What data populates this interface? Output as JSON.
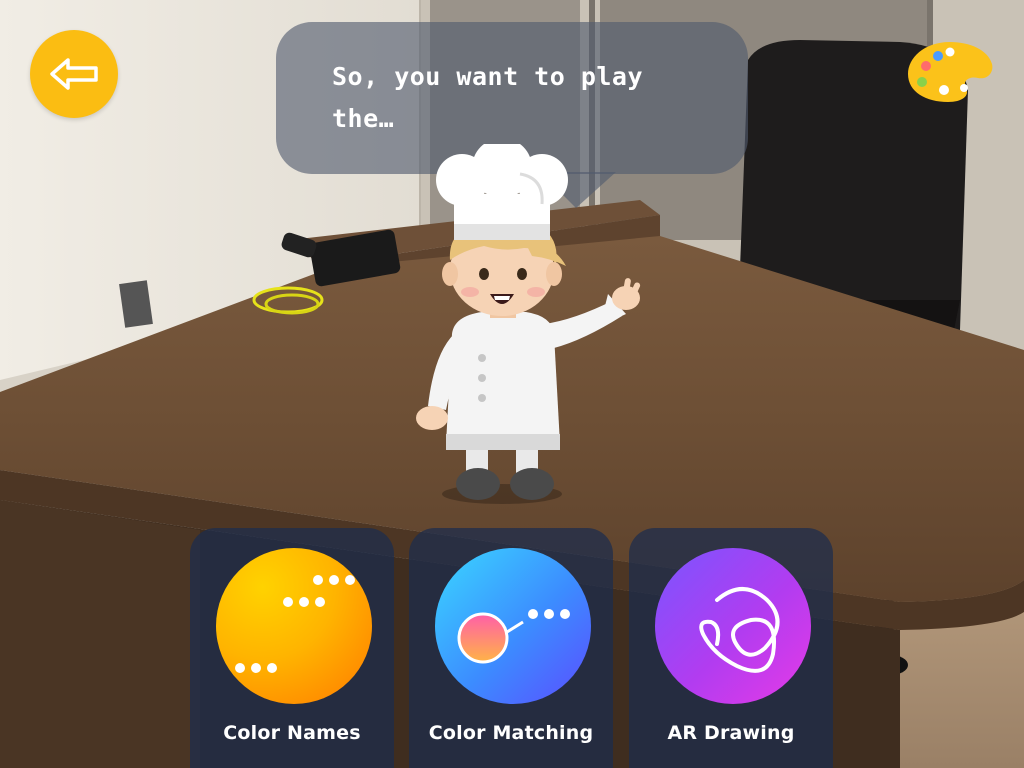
{
  "bubble": {
    "line1": "So, you want to play",
    "line2": "the…"
  },
  "toolbar": {
    "back_icon": "arrow-left-icon",
    "palette_icon": "paint-palette-icon"
  },
  "games": [
    {
      "label": "Color Names",
      "icon": "dots-icon",
      "color": "#ffb400"
    },
    {
      "label": "Color Matching",
      "icon": "match-icon",
      "color": "#3c8cff"
    },
    {
      "label": "AR Drawing",
      "icon": "scribble-icon",
      "color": "#b23cf0"
    }
  ],
  "colors": {
    "accent": "#fbbd12",
    "bubble": "#505a6e",
    "card": "#1c2c4e"
  }
}
